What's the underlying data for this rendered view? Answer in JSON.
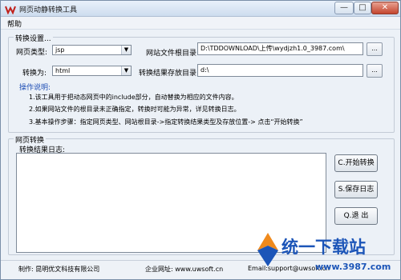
{
  "window": {
    "title": "网页动静转换工具"
  },
  "titlebar": {
    "minimize_glyph": "—",
    "maximize_glyph": "□",
    "close_glyph": "✕"
  },
  "menu": {
    "help": "帮助"
  },
  "settings": {
    "legend": "转换设置...",
    "page_type_label": "网页类型:",
    "page_type_value": "jsp",
    "site_root_label": "网站文件根目录:",
    "site_root_value": "D:\\TDDOWNLOAD\\上传\\wydjzh1.0_3987.com\\",
    "convert_to_label": "转换为:",
    "convert_to_value": "html",
    "output_dir_label": "转换结果存放目录:",
    "output_dir_value": "d:\\",
    "browse_label": "...",
    "dropdown_glyph": "▼"
  },
  "instructions": {
    "title": "操作说明:",
    "items": [
      "1.该工具用于把动态网页中的include部分，自动替换为相应的文件内容。",
      "2.如果网站文件的根目录未正确指定，转换时可能为异常，详见转换日志。",
      "3.基本操作步骤：指定网页类型、网站根目录->指定转换结果类型及存放位置-> 点击“开始转换”"
    ]
  },
  "conversion": {
    "legend": "网页转换",
    "log_label": "转换结果日志:",
    "log_text": "",
    "start_button": "C.开始转换",
    "save_log_button": "S.保存日志",
    "exit_button": "Q.退 出"
  },
  "status": {
    "author": "制作: 昆明优文科技有限公司",
    "website": "企业网址: www.uwsoft.cn",
    "email": "Email:support@uwsoft.cn"
  },
  "watermark": {
    "text": "统一下载站",
    "url": "www.3987.com"
  },
  "colors": {
    "instruction_title": "#1f4fb5",
    "watermark": "#1c55b8",
    "close_button": "#c4452e"
  }
}
